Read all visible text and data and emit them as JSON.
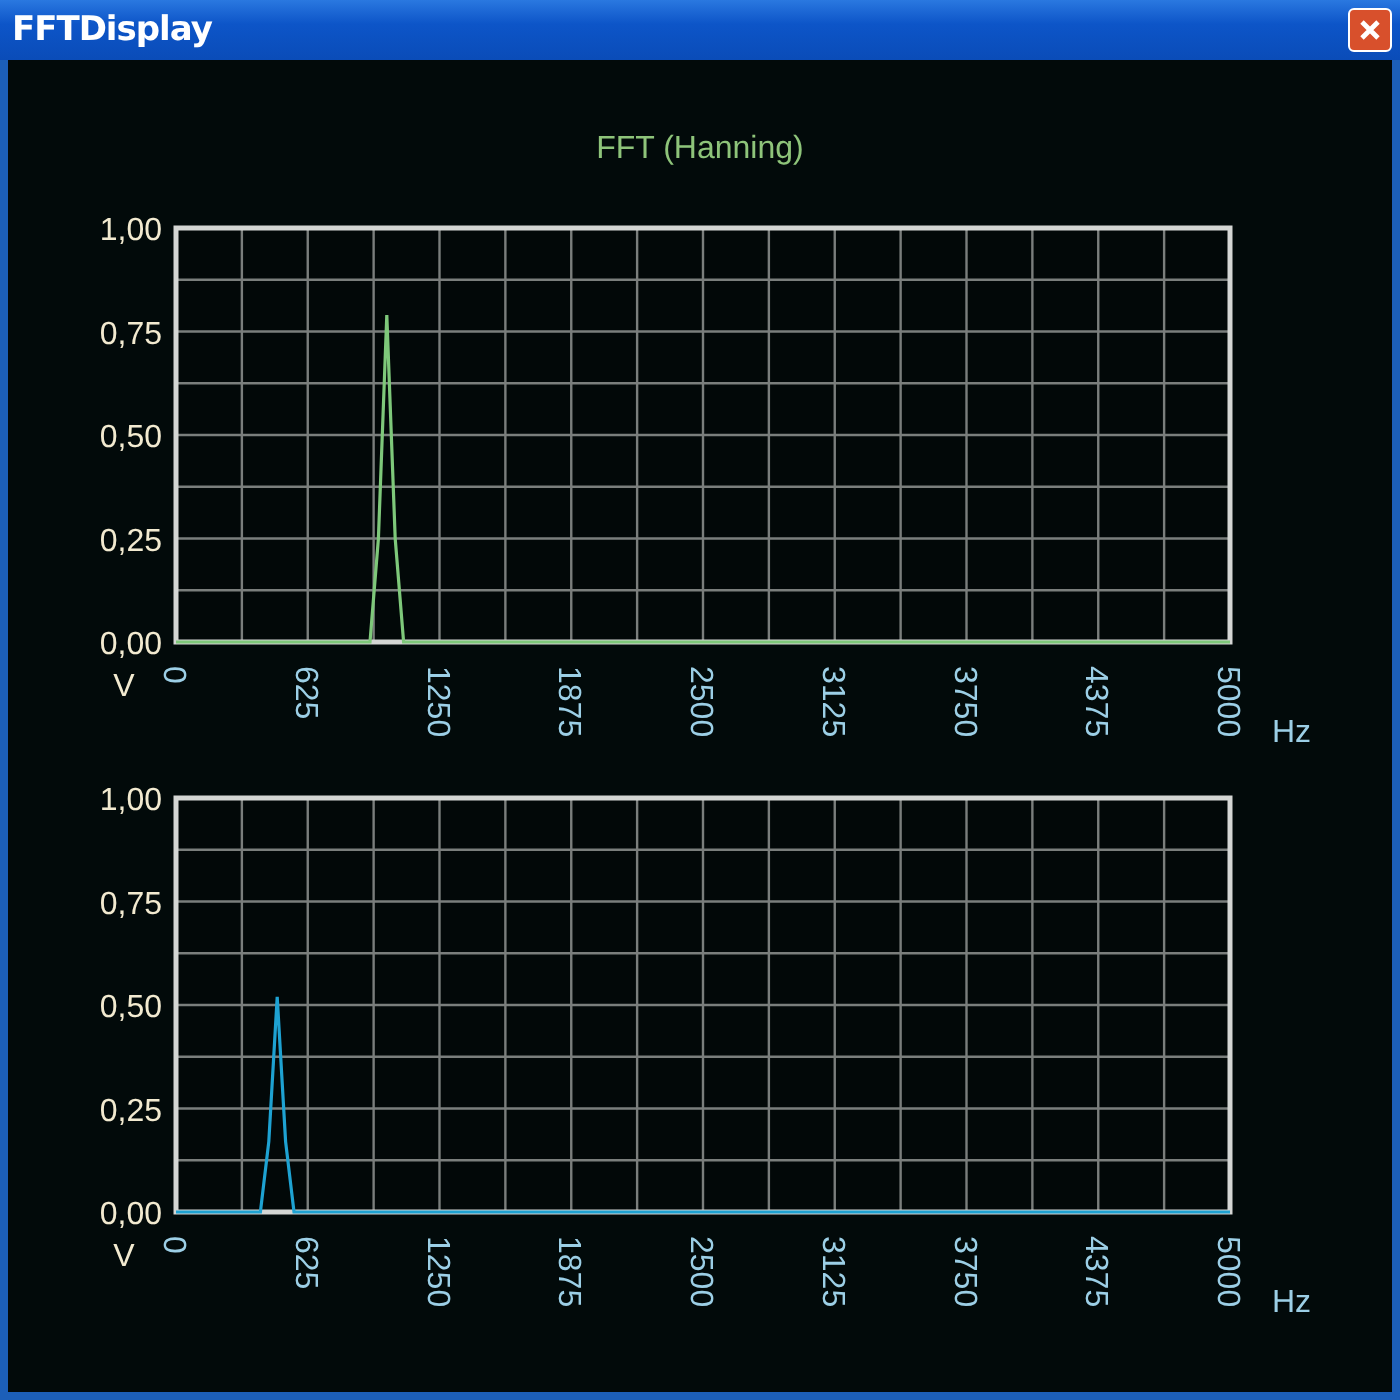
{
  "window": {
    "title": "FFTDisplay"
  },
  "title": "FFT (Hanning)",
  "charts": [
    {
      "chart_data": {
        "type": "line",
        "xlabel": "Hz",
        "ylabel": "V",
        "xlim": [
          0,
          5000
        ],
        "ylim": [
          0,
          1
        ],
        "xticks": [
          0,
          625,
          1250,
          1875,
          2500,
          3125,
          3750,
          4375,
          5000
        ],
        "yticks": [
          {
            "value": 0,
            "label": "0,00"
          },
          {
            "value": 0.25,
            "label": "0,25"
          },
          {
            "value": 0.5,
            "label": "0,50"
          },
          {
            "value": 0.75,
            "label": "0,75"
          },
          {
            "value": 1,
            "label": "1,00"
          }
        ],
        "x": [
          0,
          920,
          960,
          1000,
          1040,
          1080,
          5000
        ],
        "grid": true,
        "series": [
          {
            "color": "#7ec87a",
            "values": [
              0,
              0,
              0.25,
              0.79,
              0.25,
              0,
              0
            ]
          }
        ]
      }
    },
    {
      "chart_data": {
        "type": "line",
        "xlabel": "Hz",
        "ylabel": "V",
        "xlim": [
          0,
          5000
        ],
        "ylim": [
          0,
          1
        ],
        "xticks": [
          0,
          625,
          1250,
          1875,
          2500,
          3125,
          3750,
          4375,
          5000
        ],
        "yticks": [
          {
            "value": 0,
            "label": "0,00"
          },
          {
            "value": 0.25,
            "label": "0,25"
          },
          {
            "value": 0.5,
            "label": "0,50"
          },
          {
            "value": 0.75,
            "label": "0,75"
          },
          {
            "value": 1,
            "label": "1,00"
          }
        ],
        "x": [
          0,
          400,
          440,
          480,
          520,
          560,
          5000
        ],
        "grid": true,
        "series": [
          {
            "color": "#1ea2d2",
            "values": [
              0,
              0,
              0.17,
              0.52,
              0.17,
              0,
              0
            ]
          }
        ]
      }
    }
  ]
}
